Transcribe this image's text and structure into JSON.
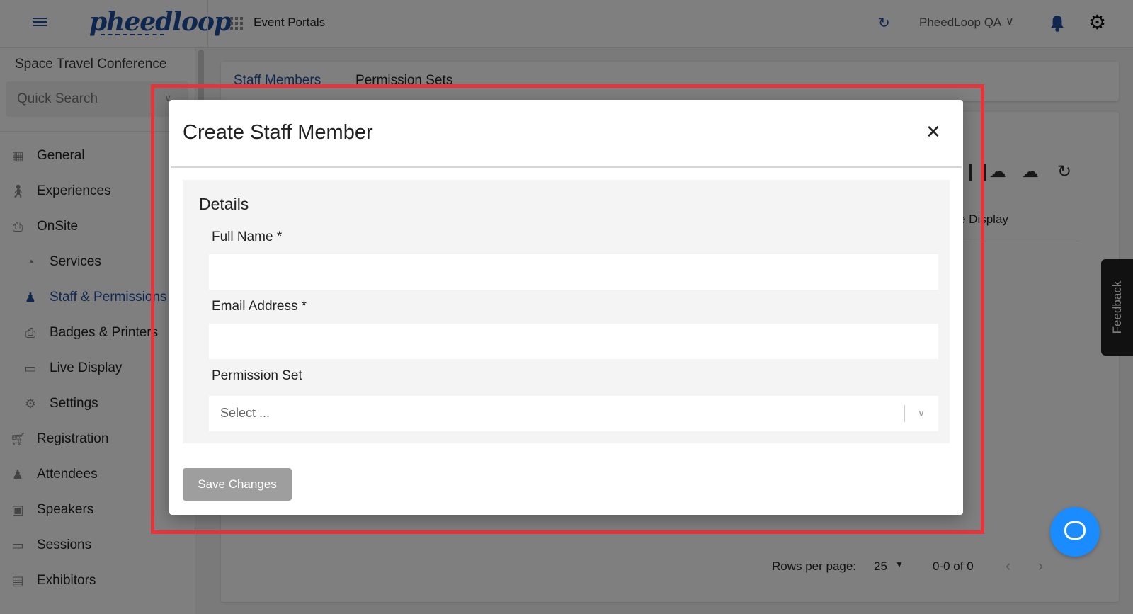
{
  "topbar": {
    "logo_text": "pheedloop",
    "portals_label": "Event Portals",
    "org_name": "PheedLoop QA"
  },
  "sidebar": {
    "event_name": "Space Travel Conference",
    "quick_search_placeholder": "Quick Search",
    "items": [
      {
        "label": "General",
        "icon": "grid-icon"
      },
      {
        "label": "Experiences",
        "icon": "person-icon"
      },
      {
        "label": "OnSite",
        "icon": "printer-icon"
      },
      {
        "label": "Services",
        "icon": "services-icon"
      },
      {
        "label": "Staff & Permissions",
        "icon": "people-icon",
        "active": true
      },
      {
        "label": "Badges & Printers",
        "icon": "printer-icon"
      },
      {
        "label": "Live Display",
        "icon": "monitor-icon"
      },
      {
        "label": "Settings",
        "icon": "gear-icon"
      },
      {
        "label": "Registration",
        "icon": "cart-icon"
      },
      {
        "label": "Attendees",
        "icon": "people-icon"
      },
      {
        "label": "Speakers",
        "icon": "speaker-icon"
      },
      {
        "label": "Sessions",
        "icon": "laptop-icon"
      },
      {
        "label": "Exhibitors",
        "icon": "store-icon"
      }
    ]
  },
  "main": {
    "tabs": [
      {
        "label": "Staff Members",
        "active": true
      },
      {
        "label": "Permission Sets",
        "active": false
      }
    ],
    "column_header_partial": "e Display",
    "pagination": {
      "rows_per_page_label": "Rows per page:",
      "rows_per_page_value": "25",
      "range": "0-0 of 0"
    }
  },
  "feedback_label": "Feedback",
  "modal": {
    "title": "Create Staff Member",
    "section_title": "Details",
    "fields": {
      "full_name_label": "Full Name *",
      "full_name_value": "",
      "email_label": "Email Address *",
      "email_value": "",
      "permission_label": "Permission Set",
      "permission_placeholder": "Select ..."
    },
    "save_label": "Save Changes"
  },
  "colors": {
    "brand": "#1f4e9c",
    "highlight": "#e8333a",
    "chat_button": "#1a8cff",
    "save_disabled": "#9e9e9e"
  }
}
